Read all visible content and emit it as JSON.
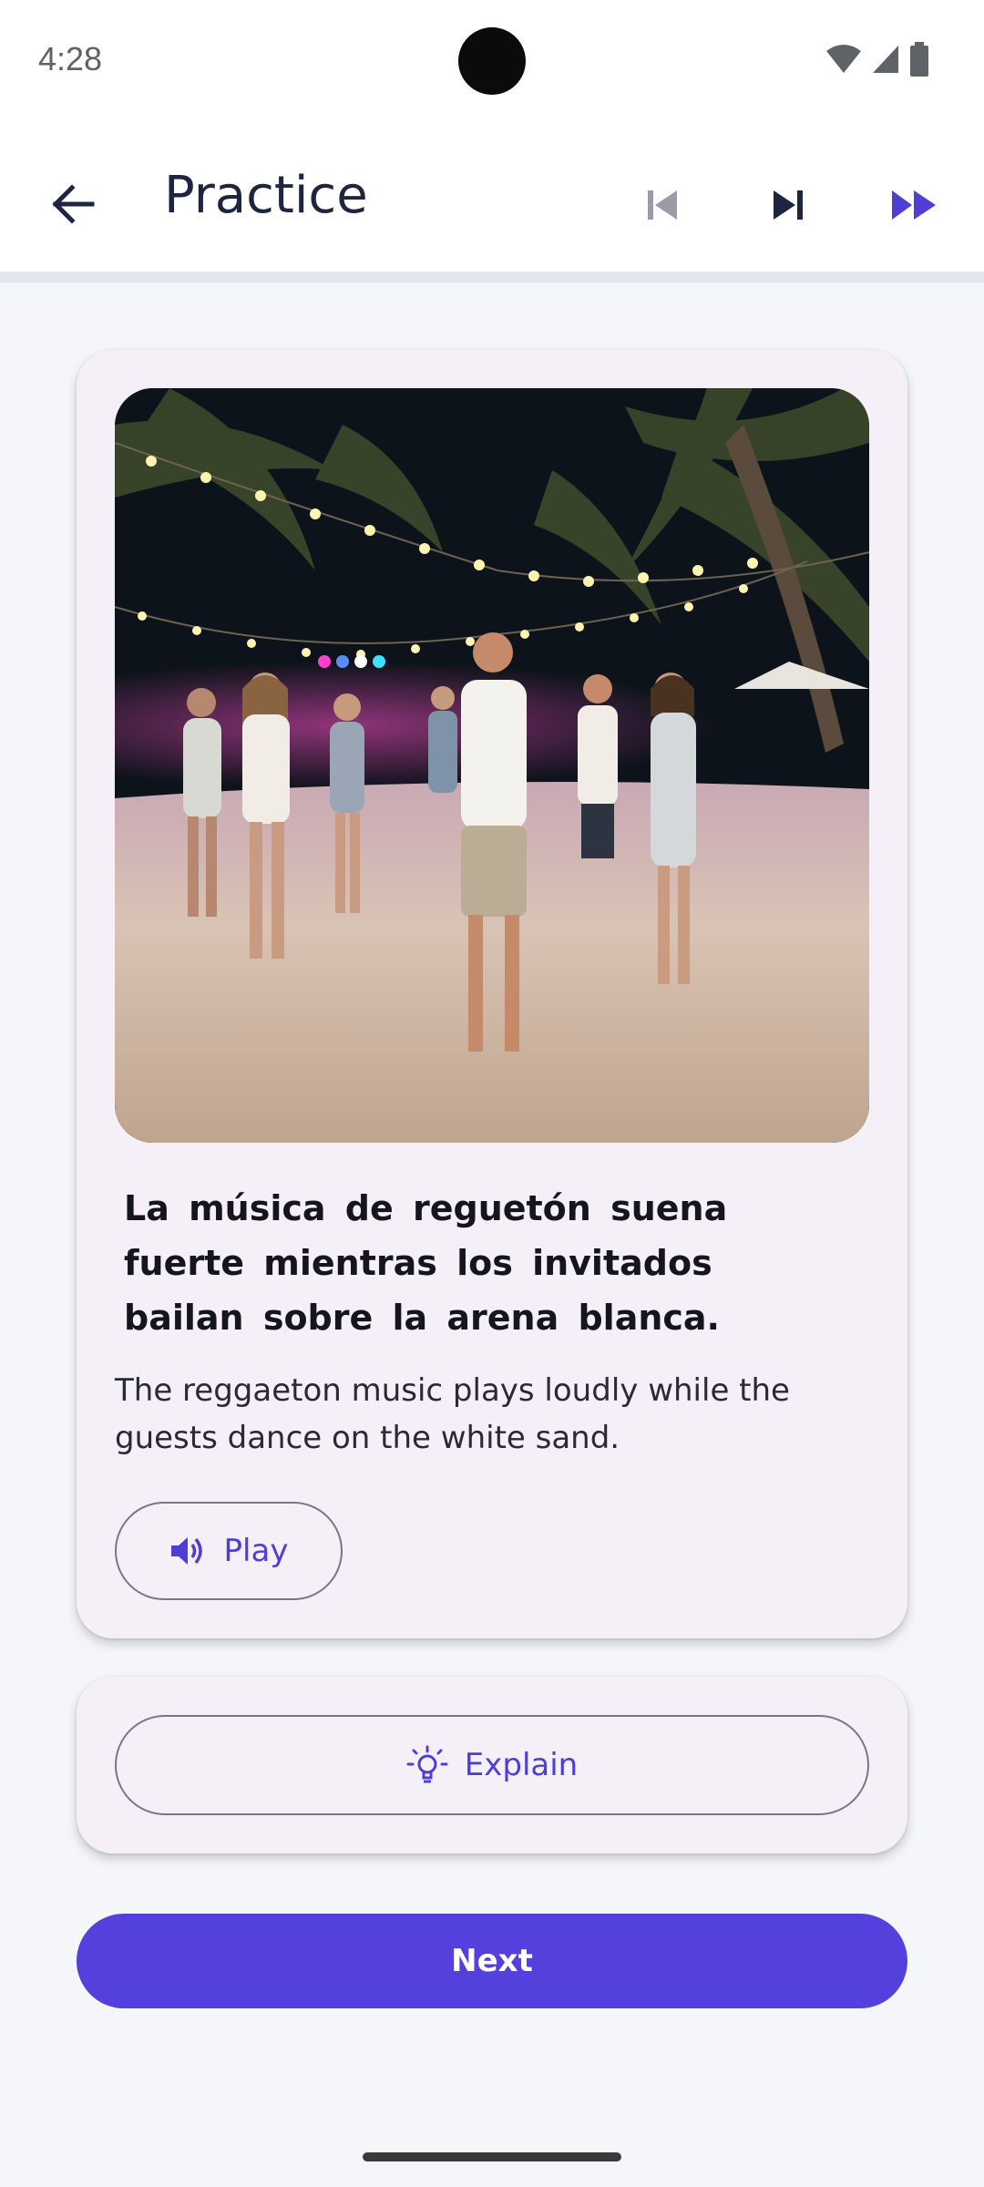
{
  "status_bar": {
    "time": "4:28"
  },
  "app_bar": {
    "title": "Practice",
    "icons": [
      "back-arrow-icon",
      "skip-previous-icon",
      "skip-next-icon",
      "fast-forward-icon"
    ]
  },
  "exercise": {
    "image_description": "Night beach party with people dancing on sand under string lights and palm trees",
    "spanish_sentence": "La música de reguetón suena fuerte mientras los invitados bailan sobre la arena blanca.",
    "english_translation": "The reggaeton music plays loudly while the guests dance on the white sand.",
    "play_label": "Play"
  },
  "explain": {
    "label": "Explain"
  },
  "next": {
    "label": "Next"
  },
  "colors": {
    "accent": "#5440dc",
    "accent_text": "#4d3fd6",
    "card_bg": "#f5f0f7",
    "page_bg": "#f5f6fa"
  }
}
